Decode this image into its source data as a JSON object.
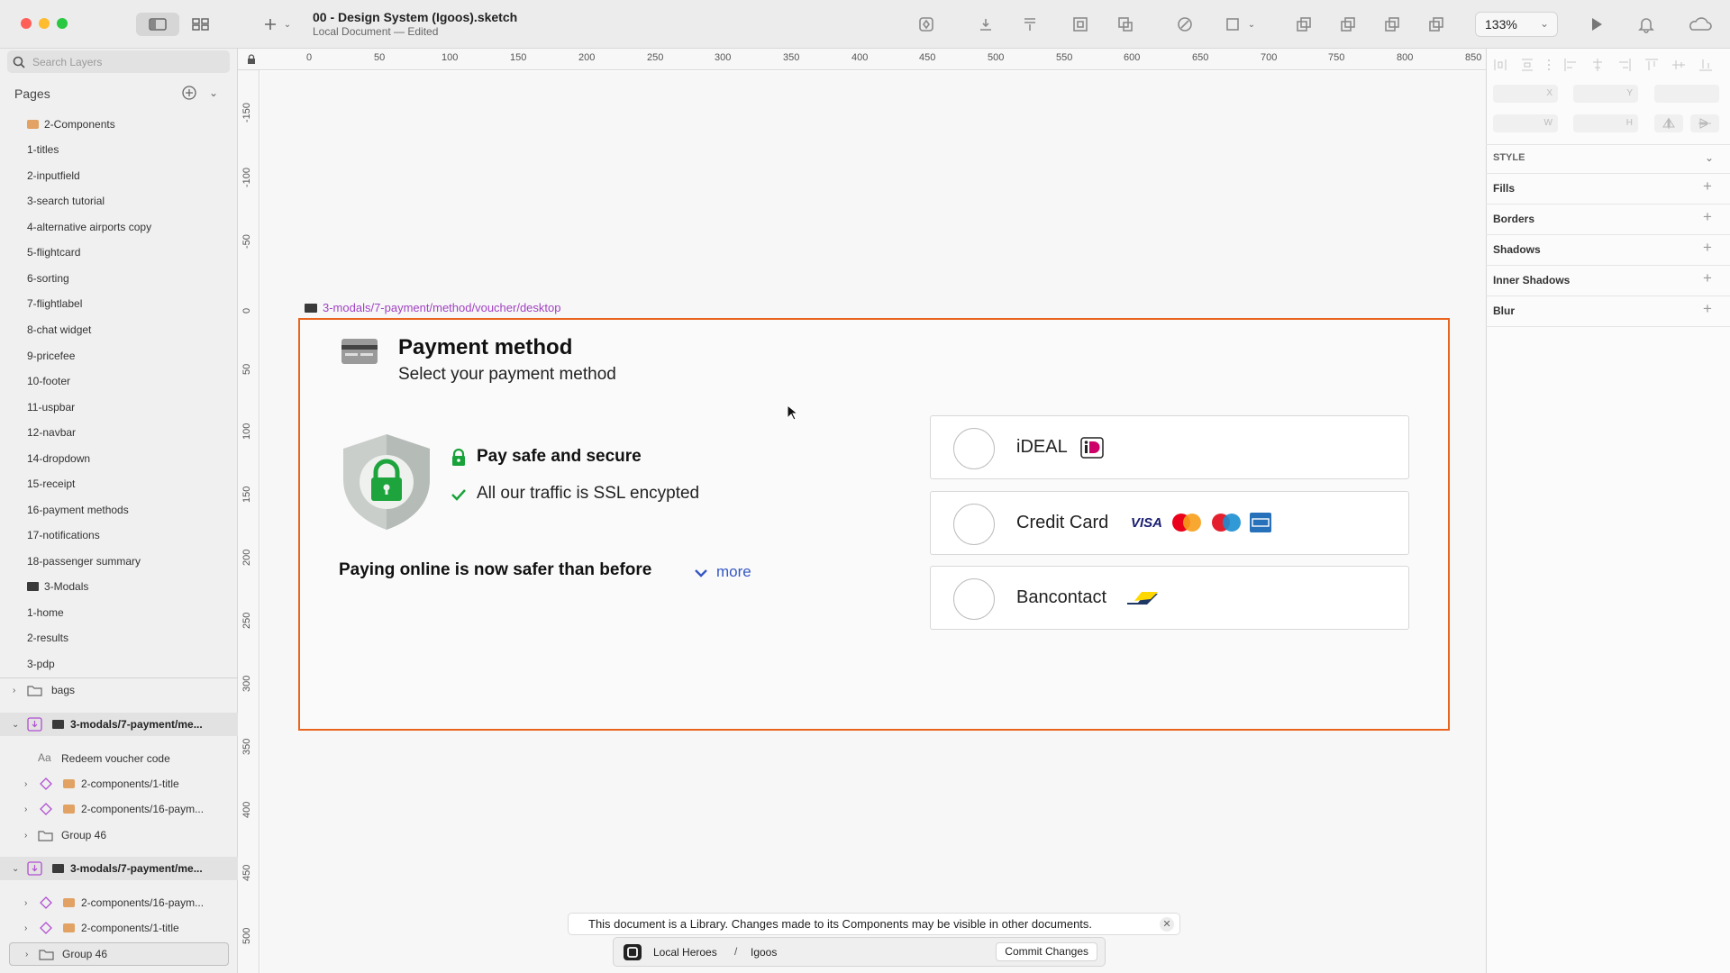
{
  "window": {
    "doc_title": "00 - Design System (Igoos).sketch",
    "doc_subtitle": "Local Document — Edited",
    "zoom": "133%"
  },
  "sidebar": {
    "search_placeholder": "Search Layers",
    "pages_header": "Pages",
    "pages": [
      "2-Components",
      "1-titles",
      "2-inputfield",
      "3-search tutorial",
      "4-alternative airports copy",
      "5-flightcard",
      "6-sorting",
      "7-flightlabel",
      "8-chat widget",
      "9-pricefee",
      "10-footer",
      "11-uspbar",
      "12-navbar",
      "14-dropdown",
      "15-receipt",
      "16-payment methods",
      "17-notifications",
      "18-passenger summary",
      "3-Modals",
      "1-home",
      "2-results",
      "3-pdp"
    ],
    "layers": [
      "bags",
      "3-modals/7-payment/me...",
      "Redeem voucher code",
      "2-components/1-title",
      "2-components/16-paym...",
      "Group 46",
      "3-modals/7-payment/me...",
      "2-components/16-paym...",
      "2-components/1-title",
      "Group 46"
    ]
  },
  "ruler": {
    "top": [
      "0",
      "50",
      "100",
      "150",
      "200",
      "250",
      "300",
      "350",
      "400",
      "450",
      "500",
      "550",
      "600",
      "650",
      "700",
      "750",
      "800",
      "850"
    ],
    "left": [
      "-150",
      "-100",
      "-50",
      "0",
      "50",
      "100",
      "150",
      "200",
      "250",
      "300",
      "350",
      "400",
      "450",
      "500"
    ]
  },
  "canvas": {
    "artboard_name": "3-modals/7-payment/method/voucher/desktop",
    "title": "Payment method",
    "subtitle": "Select your payment method",
    "pay_safe": "Pay safe and secure",
    "ssl": "All our traffic is SSL encypted",
    "paying_online": "Paying online is now safer than before",
    "more": "more",
    "options": [
      {
        "label": "iDEAL"
      },
      {
        "label": "Credit Card",
        "visa": "VISA"
      },
      {
        "label": "Bancontact"
      }
    ]
  },
  "inspector": {
    "style": "STYLE",
    "sections": [
      "Fills",
      "Borders",
      "Shadows",
      "Inner Shadows",
      "Blur"
    ],
    "fields": {
      "x": "X",
      "y": "Y",
      "w": "W",
      "h": "H"
    }
  },
  "banner": {
    "text": "This document is a Library. Changes made to its Components may be visible in other documents."
  },
  "git": {
    "team": "Local Heroes",
    "sep": "/",
    "project": "Igoos",
    "commit": "Commit Changes"
  },
  "colors": {
    "artboard_border": "#e9651f",
    "link": "#3557c4",
    "secure_green": "#19a23a",
    "artboard_label": "#a142c2"
  }
}
